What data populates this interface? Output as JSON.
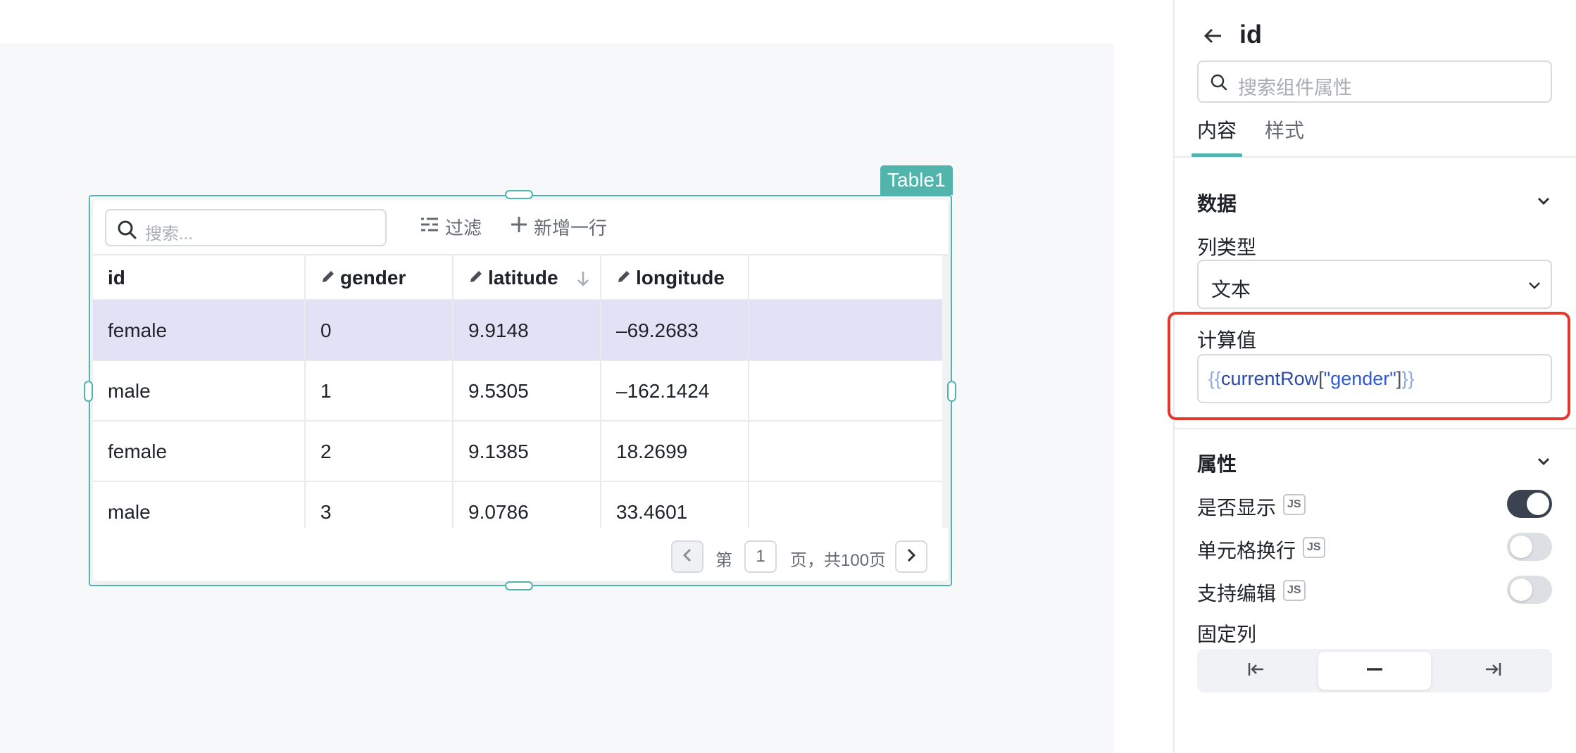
{
  "component": {
    "tag": "Table1"
  },
  "table": {
    "search_placeholder": "搜索...",
    "filter_label": "过滤",
    "add_row_label": "新增一行",
    "columns": [
      {
        "label": "id",
        "editable": false
      },
      {
        "label": "gender",
        "editable": true
      },
      {
        "label": "latitude",
        "editable": true,
        "sorted": "desc"
      },
      {
        "label": "longitude",
        "editable": true
      }
    ],
    "rows": [
      [
        "female",
        "0",
        "9.9148",
        "–69.2683"
      ],
      [
        "male",
        "1",
        "9.5305",
        "–162.1424"
      ],
      [
        "female",
        "2",
        "9.1385",
        "18.2699"
      ],
      [
        "male",
        "3",
        "9.0786",
        "33.4601"
      ]
    ],
    "selected_row": 0,
    "pagination": {
      "prefix": "第",
      "page": "1",
      "suffix": "页，共100页"
    }
  },
  "panel": {
    "title": "id",
    "search_placeholder": "搜索组件属性",
    "tabs": [
      {
        "label": "内容",
        "active": true
      },
      {
        "label": "样式",
        "active": false
      }
    ],
    "data_section": {
      "title": "数据",
      "column_type_label": "列类型",
      "column_type_value": "文本",
      "computed_label": "计算值",
      "computed_value": {
        "open": "{{",
        "ident": "currentRow",
        "bracket_open": "[",
        "string": "\"gender\"",
        "bracket_close": "]",
        "close": "}}"
      }
    },
    "props_section": {
      "title": "属性",
      "items": [
        {
          "label": "是否显示",
          "badge": "JS",
          "on": true
        },
        {
          "label": "单元格换行",
          "badge": "JS",
          "on": false
        },
        {
          "label": "支持编辑",
          "badge": "JS",
          "on": false
        }
      ],
      "fixed_label": "固定列",
      "fixed_options": [
        "pin-left-icon",
        "no-pin-icon",
        "pin-right-icon"
      ],
      "fixed_selected": 1
    }
  },
  "colors": {
    "accent": "#51b5ad",
    "selected_row": "#e3e1f5",
    "highlight_border": "#e5362c",
    "toggle_on": "#3b4350"
  }
}
